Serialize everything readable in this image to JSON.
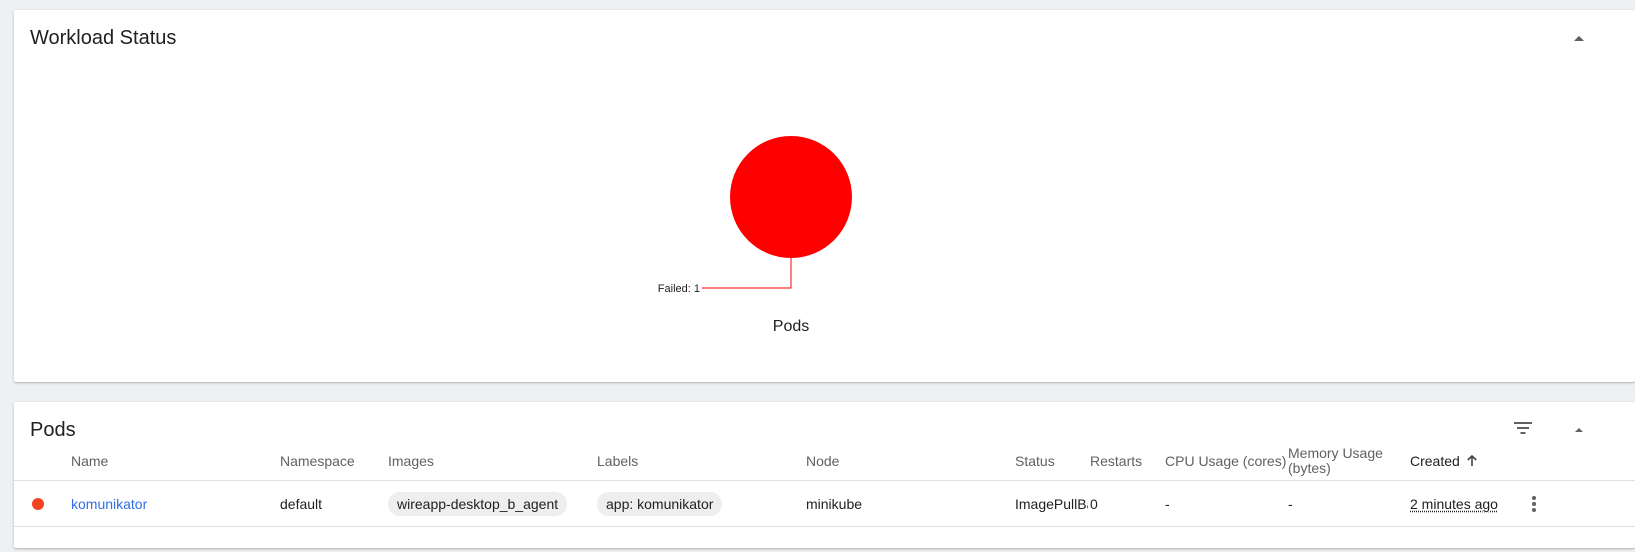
{
  "workload": {
    "title": "Workload Status",
    "chart_caption": "Pods",
    "failed_label": "Failed: 1"
  },
  "chart_data": {
    "type": "pie",
    "title": "Pods",
    "slices": [
      {
        "label": "Failed",
        "value": 1,
        "color": "#ff0000"
      }
    ]
  },
  "pods": {
    "title": "Pods",
    "columns": {
      "name": "Name",
      "namespace": "Namespace",
      "images": "Images",
      "labels": "Labels",
      "node": "Node",
      "status": "Status",
      "restarts": "Restarts",
      "cpu": "CPU Usage (cores)",
      "memory_line1": "Memory Usage",
      "memory_line2": "(bytes)",
      "created": "Created"
    },
    "rows": [
      {
        "status_color": "#f44321",
        "name": "komunikator",
        "namespace": "default",
        "image": "wireapp-desktop_b_agent",
        "label": "app: komunikator",
        "node": "minikube",
        "status": "ImagePullBackOff",
        "restarts": "0",
        "cpu": "-",
        "memory": "-",
        "created": "2 minutes ago"
      }
    ]
  },
  "icons": {
    "collapse": "chevron-up-icon",
    "filter": "filter-icon",
    "sort": "arrow-up-icon",
    "menu": "more-vert-icon"
  }
}
